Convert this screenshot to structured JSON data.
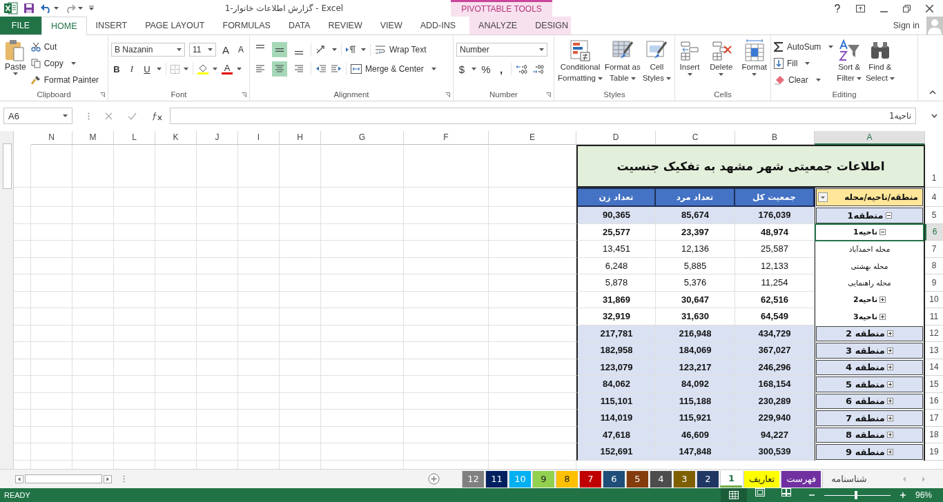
{
  "window": {
    "title": "گزارش اطلاعات خانوار-1 - Excel",
    "context_title": "PIVOTTABLE TOOLS"
  },
  "tabs": [
    {
      "label": "FILE",
      "kind": "file",
      "selected": false
    },
    {
      "label": "HOME",
      "kind": "normal",
      "selected": true
    },
    {
      "label": "INSERT",
      "kind": "normal",
      "selected": false
    },
    {
      "label": "PAGE LAYOUT",
      "kind": "normal",
      "selected": false
    },
    {
      "label": "FORMULAS",
      "kind": "normal",
      "selected": false
    },
    {
      "label": "DATA",
      "kind": "normal",
      "selected": false
    },
    {
      "label": "REVIEW",
      "kind": "normal",
      "selected": false
    },
    {
      "label": "VIEW",
      "kind": "normal",
      "selected": false
    },
    {
      "label": "ADD-INS",
      "kind": "normal",
      "selected": false
    },
    {
      "label": "ANALYZE",
      "kind": "contextual",
      "selected": false
    },
    {
      "label": "DESIGN",
      "kind": "contextual",
      "selected": false
    }
  ],
  "sign_in": "Sign in",
  "ribbon": {
    "clipboard": {
      "label": "Clipboard",
      "paste": "Paste",
      "cut": "Cut",
      "copy": "Copy",
      "format_painter": "Format Painter"
    },
    "font": {
      "label": "Font",
      "name": "B Nazanin",
      "size": "11",
      "grow": "A",
      "shrink": "A",
      "bold": "B",
      "italic": "I",
      "underline": "U",
      "font_color": "A"
    },
    "alignment": {
      "label": "Alignment",
      "vertical": [
        {
          "kind": "top",
          "selected": false
        },
        {
          "kind": "middle",
          "selected": true
        },
        {
          "kind": "bottom",
          "selected": false
        }
      ],
      "horizontal": [
        {
          "kind": "left",
          "selected": false
        },
        {
          "kind": "center",
          "selected": true
        },
        {
          "kind": "right",
          "selected": false
        }
      ],
      "wrap_text": "Wrap Text",
      "merge_center": "Merge & Center"
    },
    "number": {
      "label": "Number",
      "format": "Number",
      "currency": "$",
      "percent": "%",
      "comma": ","
    },
    "styles": {
      "label": "Styles",
      "buttons": [
        {
          "kind": "conditional",
          "lines": [
            "Conditional",
            "Formatting"
          ]
        },
        {
          "kind": "table",
          "lines": [
            "Format as",
            "Table"
          ]
        },
        {
          "kind": "cell",
          "lines": [
            "Cell",
            "Styles"
          ]
        }
      ]
    },
    "cells": {
      "label": "Cells",
      "buttons": [
        {
          "kind": "insert",
          "label": "Insert"
        },
        {
          "kind": "delete",
          "label": "Delete"
        },
        {
          "kind": "format",
          "label": "Format"
        }
      ]
    },
    "editing": {
      "label": "Editing",
      "autosum": "AutoSum",
      "fill": "Fill",
      "clear": "Clear",
      "sort": [
        "Sort &",
        "Filter"
      ],
      "find": [
        "Find &",
        "Select"
      ]
    }
  },
  "formula_bar": {
    "name_box": "A6",
    "formula": "ناحیه1"
  },
  "columns": [
    {
      "letter": "N",
      "selected": false
    },
    {
      "letter": "M",
      "selected": false
    },
    {
      "letter": "L",
      "selected": false
    },
    {
      "letter": "K",
      "selected": false
    },
    {
      "letter": "J",
      "selected": false
    },
    {
      "letter": "I",
      "selected": false
    },
    {
      "letter": "H",
      "selected": false
    },
    {
      "letter": "G",
      "selected": false
    },
    {
      "letter": "F",
      "selected": false
    },
    {
      "letter": "E",
      "selected": false
    },
    {
      "letter": "D",
      "selected": false
    },
    {
      "letter": "C",
      "selected": false
    },
    {
      "letter": "B",
      "selected": false
    },
    {
      "letter": "A",
      "selected": true
    }
  ],
  "title_row": {
    "row": "1",
    "text": "اطلاعات جمعیتی شهر مشهد به تفکیک جنسیت"
  },
  "header_row": {
    "row": "4",
    "cells": [
      "منطقه/ناحیه/محله",
      "جمعیت کل",
      "تعداد مرد",
      "تعداد زن"
    ]
  },
  "rows": [
    {
      "row": "5",
      "label": "منطقه1",
      "kind": "region",
      "expanded": true,
      "total": "176,039",
      "male": "85,674",
      "female": "90,365",
      "selected": false
    },
    {
      "row": "6",
      "label": "ناحیه1",
      "kind": "district",
      "expanded": true,
      "total": "48,974",
      "male": "23,397",
      "female": "25,577",
      "selected": true
    },
    {
      "row": "7",
      "label": "محله احمدآباد",
      "kind": "neighborhood",
      "total": "25,587",
      "male": "12,136",
      "female": "13,451",
      "selected": false
    },
    {
      "row": "8",
      "label": "محله بهشتی",
      "kind": "neighborhood",
      "total": "12,133",
      "male": "5,885",
      "female": "6,248",
      "selected": false
    },
    {
      "row": "9",
      "label": "محله راهنمایی",
      "kind": "neighborhood",
      "total": "11,254",
      "male": "5,376",
      "female": "5,878",
      "selected": false
    },
    {
      "row": "10",
      "label": "ناحیه2",
      "kind": "district",
      "expanded": false,
      "total": "62,516",
      "male": "30,647",
      "female": "31,869",
      "selected": false
    },
    {
      "row": "11",
      "label": "ناحیه3",
      "kind": "district",
      "expanded": false,
      "total": "64,549",
      "male": "31,630",
      "female": "32,919",
      "selected": false
    },
    {
      "row": "12",
      "label": "منطقه 2",
      "kind": "region",
      "expanded": false,
      "total": "434,729",
      "male": "216,948",
      "female": "217,781",
      "selected": false
    },
    {
      "row": "13",
      "label": "منطقه 3",
      "kind": "region",
      "expanded": false,
      "total": "367,027",
      "male": "184,069",
      "female": "182,958",
      "selected": false
    },
    {
      "row": "14",
      "label": "منطقه 4",
      "kind": "region",
      "expanded": false,
      "total": "246,296",
      "male": "123,217",
      "female": "123,079",
      "selected": false
    },
    {
      "row": "15",
      "label": "منطقه 5",
      "kind": "region",
      "expanded": false,
      "total": "168,154",
      "male": "84,092",
      "female": "84,062",
      "selected": false
    },
    {
      "row": "16",
      "label": "منطقه 6",
      "kind": "region",
      "expanded": false,
      "total": "230,289",
      "male": "115,188",
      "female": "115,101",
      "selected": false
    },
    {
      "row": "17",
      "label": "منطقه 7",
      "kind": "region",
      "expanded": false,
      "total": "229,940",
      "male": "115,921",
      "female": "114,019",
      "selected": false
    },
    {
      "row": "18",
      "label": "منطقه 8",
      "kind": "region",
      "expanded": false,
      "total": "94,227",
      "male": "46,609",
      "female": "47,618",
      "selected": false
    },
    {
      "row": "19",
      "label": "منطقه 9",
      "kind": "region",
      "expanded": false,
      "total": "300,539",
      "male": "147,848",
      "female": "152,691",
      "selected": false
    }
  ],
  "sheet_tabs": [
    {
      "label": "12",
      "color": "#808080",
      "selected": false
    },
    {
      "label": "11",
      "color": "#002060",
      "selected": false
    },
    {
      "label": "10",
      "color": "#00b0f0",
      "selected": false
    },
    {
      "label": "9",
      "color": "#92d050",
      "selected": false
    },
    {
      "label": "8",
      "color": "#ffc000",
      "selected": false
    },
    {
      "label": "7",
      "color": "#c00000",
      "selected": false
    },
    {
      "label": "6",
      "color": "#1f4e78",
      "selected": false
    },
    {
      "label": "5",
      "color": "#843c0c",
      "selected": false
    },
    {
      "label": "4",
      "color": "#4d4d4d",
      "selected": false
    },
    {
      "label": "3",
      "color": "#7f6000",
      "selected": false
    },
    {
      "label": "2",
      "color": "#203764",
      "selected": false
    },
    {
      "label": "1",
      "color": "#70ad47",
      "selected": true
    },
    {
      "label": "تعاریف",
      "color": "#ffff00",
      "selected": false
    },
    {
      "label": "فهرست",
      "color": "#7030a0",
      "selected": false
    },
    {
      "label": "شناسنامه",
      "selected": false
    }
  ],
  "status_bar": {
    "status": "READY",
    "zoom": {
      "level": 0.48,
      "reading": "96%"
    }
  }
}
